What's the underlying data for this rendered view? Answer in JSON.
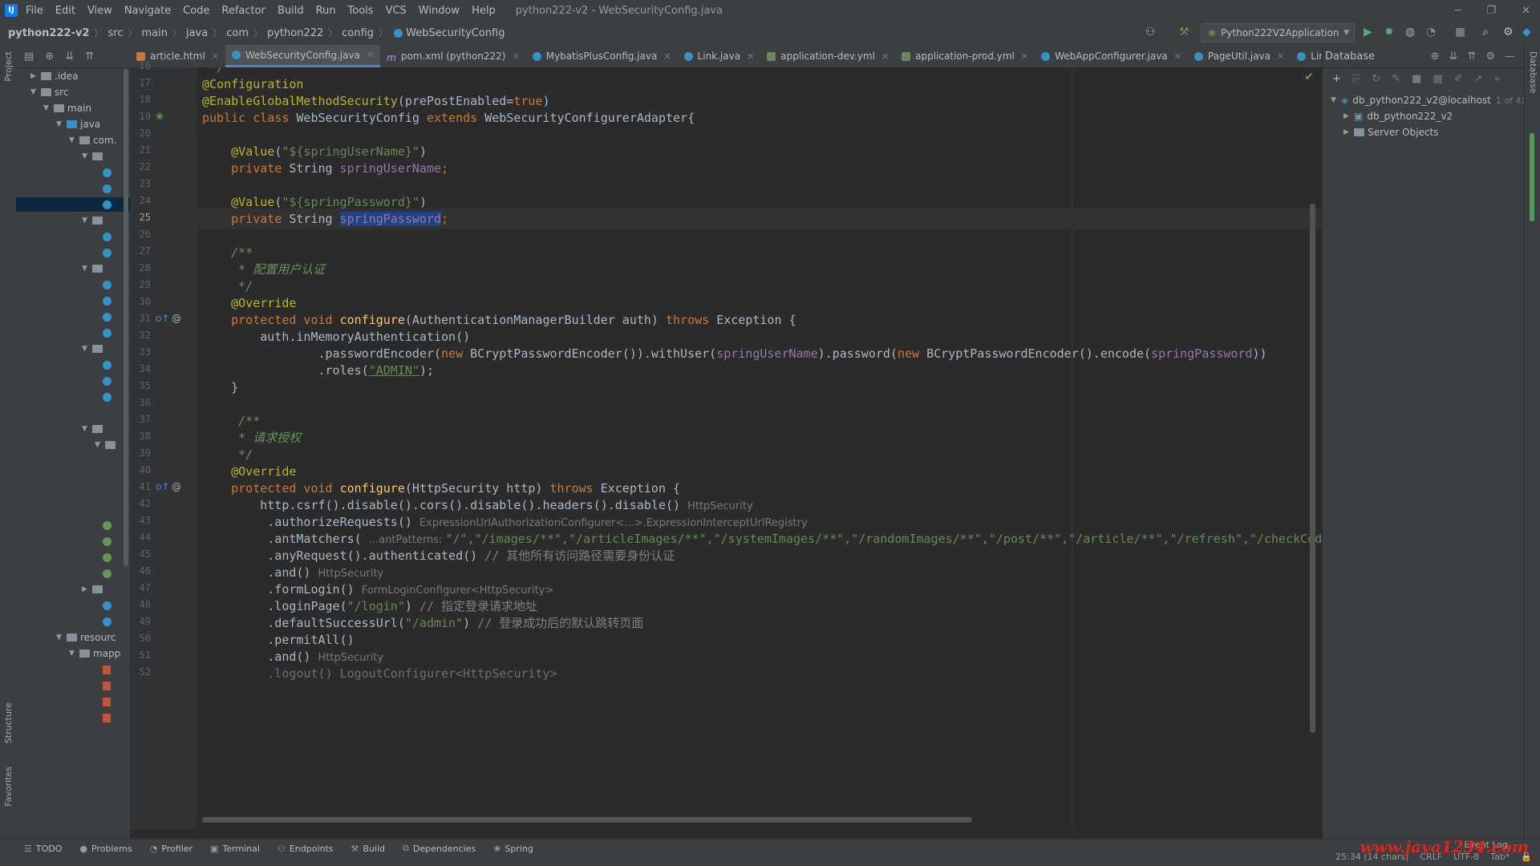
{
  "menu": {
    "items": [
      "File",
      "Edit",
      "View",
      "Navigate",
      "Code",
      "Refactor",
      "Build",
      "Run",
      "Tools",
      "VCS",
      "Window",
      "Help"
    ],
    "window_title": "python222-v2 - WebSecurityConfig.java",
    "window_controls": [
      "─",
      "❐",
      "✕"
    ]
  },
  "breadcrumb": [
    "python222-v2",
    "src",
    "main",
    "java",
    "com",
    "python222",
    "config",
    "WebSecurityConfig"
  ],
  "run_config": {
    "label": "Python222V2Application"
  },
  "project_tree": [
    {
      "label": ".idea",
      "icon": "folder"
    },
    {
      "label": "src",
      "icon": "folder"
    },
    {
      "label": "main",
      "icon": "folder"
    },
    {
      "label": "java",
      "icon": "folder"
    },
    {
      "label": "com.",
      "icon": "folder"
    },
    {
      "label": "resourc",
      "icon": "folder"
    },
    {
      "label": "mapp",
      "icon": "folder"
    }
  ],
  "tabs": [
    {
      "label": "article.html",
      "icon": "html"
    },
    {
      "label": "WebSecurityConfig.java",
      "icon": "class",
      "active": true
    },
    {
      "label": "pom.xml (python222)",
      "icon": "xml"
    },
    {
      "label": "MybatisPlusConfig.java",
      "icon": "class"
    },
    {
      "label": "Link.java",
      "icon": "class"
    },
    {
      "label": "application-dev.yml",
      "icon": "yml"
    },
    {
      "label": "application-prod.yml",
      "icon": "yml"
    },
    {
      "label": "WebAppConfigurer.java",
      "icon": "class"
    },
    {
      "label": "PageUtil.java",
      "icon": "class"
    },
    {
      "label": "Lin",
      "icon": "class"
    }
  ],
  "editor": {
    "line_numbers": [
      "16",
      "17",
      "18",
      "19",
      "20",
      "21",
      "22",
      "23",
      "24",
      "25",
      "26",
      "27",
      "28",
      "29",
      "30",
      "31",
      "32",
      "33",
      "34",
      "35",
      "36",
      "37",
      "38",
      "39",
      "40",
      "41",
      "42",
      "43",
      "44",
      "45",
      "46",
      "47",
      "48",
      "49",
      "50",
      "51",
      "52"
    ],
    "current_line": "25",
    "code": {
      "l16": " */",
      "l17": "@Configuration",
      "l18a": "@EnableGlobalMethodSecurity",
      "l18b": "(prePostEnabled=",
      "l18c": "true",
      "l18d": ")",
      "l19a": "public class ",
      "l19b": "WebSecurityConfig ",
      "l19c": "extends ",
      "l19d": "WebSecurityConfigurerAdapter{",
      "l21a": "    @Value",
      "l21b": "(",
      "l21c": "\"${springUserName}\"",
      "l21d": ")",
      "l22a": "    private ",
      "l22b": "String ",
      "l22c": "springUserName",
      "l22d": ";",
      "l24a": "    @Value",
      "l24b": "(",
      "l24c": "\"${springPassword}\"",
      "l24d": ")",
      "l25a": "    private ",
      "l25b": "String ",
      "l25c": "springPassword",
      "l25d": ";",
      "l27": "    /**",
      "l28": "     * 配置用户认证",
      "l29": "     */",
      "l30": "    @Override",
      "l31a": "    protected void ",
      "l31b": "configure",
      "l31c": "(AuthenticationManagerBuilder auth) ",
      "l31d": "throws ",
      "l31e": "Exception {",
      "l32": "        auth.inMemoryAuthentication()",
      "l33a": "                .passwordEncoder(",
      "l33b": "new ",
      "l33c": "BCryptPasswordEncoder()).withUser(",
      "l33d": "springUserName",
      "l33e": ").password(",
      "l33f": "new ",
      "l33g": "BCryptPasswordEncoder().encode(",
      "l33h": "springPassword",
      "l33i": "))",
      "l34a": "                .roles(",
      "l34b": "\"ADMIN\"",
      "l34c": ");",
      "l35": "    }",
      "l37": "     /**",
      "l38": "     * 请求授权",
      "l39": "     */",
      "l40": "    @Override",
      "l41a": "    protected void ",
      "l41b": "configure",
      "l41c": "(HttpSecurity http) ",
      "l41d": "throws ",
      "l41e": "Exception {",
      "l42a": "        http.csrf().disable().cors().disable().headers().disable() ",
      "l42h": "HttpSecurity",
      "l43a": "         .authorizeRequests() ",
      "l43h": "ExpressionUrlAuthorizationConfigurer<...>.ExpressionInterceptUrlRegistry",
      "l44a": "         .antMatchers( ",
      "l44h": "...antPatterns: ",
      "l44b": "\"/\",\"/images/**\",\"/articleImages/**\",\"/systemImages/**\",\"/randomImages/**\",\"/post/**\",\"/article/**\",\"/refresh\",\"/checkCode",
      "l45a": "         .anyRequest().authenticated() ",
      "l45c": "// 其他所有访问路径需要身份认证",
      "l46a": "         .and() ",
      "l46h": "HttpSecurity",
      "l47a": "         .formLogin() ",
      "l47h": "FormLoginConfigurer<HttpSecurity>",
      "l48a": "         .loginPage(",
      "l48b": "\"/login\"",
      "l48c": ") ",
      "l48d": "// 指定登录请求地址",
      "l49a": "         .defaultSuccessUrl(",
      "l49b": "\"/admin\"",
      "l49c": ") ",
      "l49d": "// 登录成功后的默认跳转页面",
      "l50": "         .permitAll()",
      "l51a": "         .and() ",
      "l51h": "HttpSecurity",
      "l52": "         .logout() LogoutConfigurer<HttpSecurity>"
    }
  },
  "database": {
    "title": "Database",
    "nodes": [
      {
        "label": "db_python222_v2@localhost",
        "badge": "1 of 41"
      },
      {
        "label": "db_python222_v2"
      },
      {
        "label": "Server Objects"
      }
    ]
  },
  "side_labels": {
    "project": "Project",
    "structure": "Structure",
    "favorites": "Favorites",
    "database": "Database"
  },
  "bottom_tools": [
    "TODO",
    "Problems",
    "Profiler",
    "Terminal",
    "Endpoints",
    "Build",
    "Dependencies",
    "Spring"
  ],
  "status": {
    "position": "25:34 (14 chars)",
    "line_sep": "CRLF",
    "encoding": "UTF-8",
    "indent": "Tab*",
    "event_log": "Event Log"
  },
  "watermark": "www.java1234.com",
  "colors": {
    "keyword": "#cc7832",
    "annotation": "#bbb529",
    "string": "#6a8759",
    "field": "#9876aa",
    "method": "#ffc66d",
    "selection": "#214283"
  }
}
